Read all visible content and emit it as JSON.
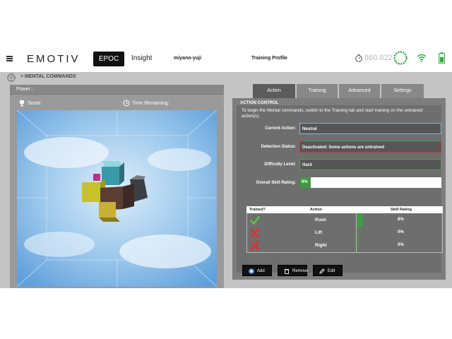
{
  "header": {
    "logo": "EMOTIV",
    "nav": {
      "epoc": "EPOC",
      "insight": "Insight"
    },
    "user": "miyano-yuji",
    "profile": "Training Profile",
    "timer_value": "860.822",
    "accent_color": "#2eaa3a"
  },
  "breadcrumb": "> MENTAL COMMANDS",
  "left_panel": {
    "power_label": "Power :",
    "score_label": "Score:",
    "time_label": "Time Remaining:"
  },
  "tabs": [
    "Action",
    "Training",
    "Advanced",
    "Settings"
  ],
  "action_control": {
    "title": "ACTION CONTROL",
    "description": "To begin the Mental commands, switch to the Training tab and start training on the untrained action(s).",
    "fields": {
      "current_action_label": "Current Action:",
      "current_action_value": "Neutral",
      "detection_status_label": "Detection Status:",
      "detection_status_value": "Deactivated: Some actions are untrained",
      "difficulty_label": "Difficulty Level:",
      "difficulty_value": "Hard",
      "skill_label": "Overall Skill Rating:",
      "skill_value": "8%",
      "skill_fraction": 0.08
    },
    "table": {
      "headers": {
        "trained": "Trained?",
        "action": "Action",
        "rating": "Skill Rating"
      },
      "rows": [
        {
          "trained": true,
          "action": "Push",
          "rating": "8%"
        },
        {
          "trained": false,
          "action": "Lift",
          "rating": "0%"
        },
        {
          "trained": false,
          "action": "Right",
          "rating": "0%"
        }
      ]
    },
    "buttons": {
      "add": "Add",
      "remove": "Remove",
      "edit": "Edit"
    }
  }
}
